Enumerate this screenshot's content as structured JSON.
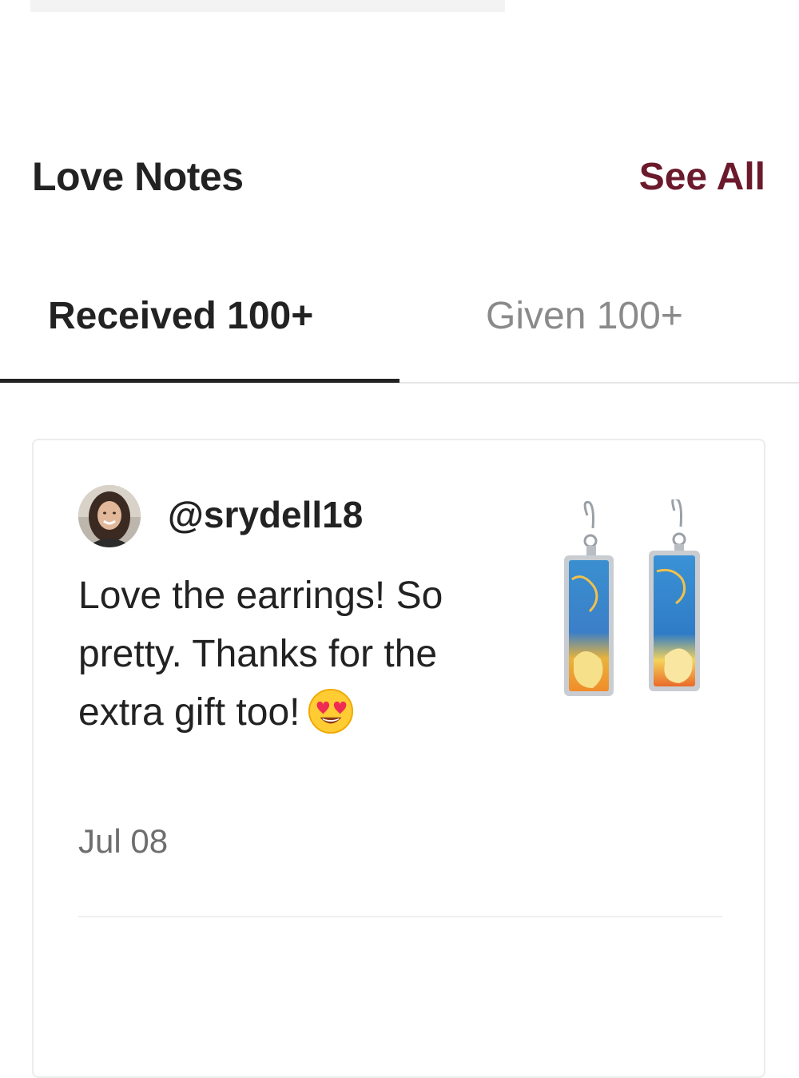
{
  "section": {
    "title": "Love Notes",
    "see_all_label": "See All",
    "accent_color": "#6b1a2c"
  },
  "tabs": [
    {
      "label": "Received 100+",
      "active": true
    },
    {
      "label": "Given 100+",
      "active": false
    }
  ],
  "notes": [
    {
      "username": "@srydell18",
      "text": "Love the earrings! So pretty. Thanks for the extra gift too!",
      "emoji": "heart-eyes-emoji",
      "date": "Jul 08",
      "product_icon": "earrings-product-image"
    }
  ]
}
